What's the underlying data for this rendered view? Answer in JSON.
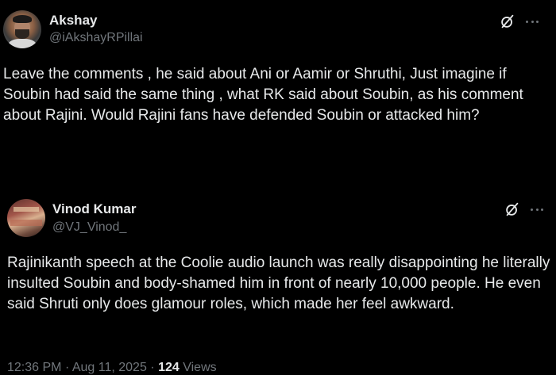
{
  "main_post": {
    "display_name": "Akshay",
    "handle": "@iAkshayRPillai",
    "text": "Leave the comments , he said about Ani or Aamir or Shruthi, Just imagine if Soubin had said the same thing , what RK said about Soubin, as his comment about Rajini. Would Rajini fans have defended Soubin or attacked him?",
    "grok_icon": "grok-icon",
    "more_icon": "more-icon"
  },
  "quoted_post": {
    "display_name": "Vinod Kumar",
    "handle": "@VJ_Vinod_",
    "text": "Rajinikanth speech at the Coolie audio launch was really disappointing he literally insulted Soubin and body-shamed him in front of nearly 10,000 people. He even said Shruti only does glamour roles, which made her feel awkward.",
    "time": "12:36 PM",
    "date": "Aug 11, 2025",
    "views_count": "124",
    "views_label": "Views",
    "separator": "·",
    "grok_icon": "grok-icon",
    "more_icon": "more-icon"
  },
  "colors": {
    "background": "#000000",
    "primary_text": "#e7e9ea",
    "secondary_text": "#71767b"
  }
}
